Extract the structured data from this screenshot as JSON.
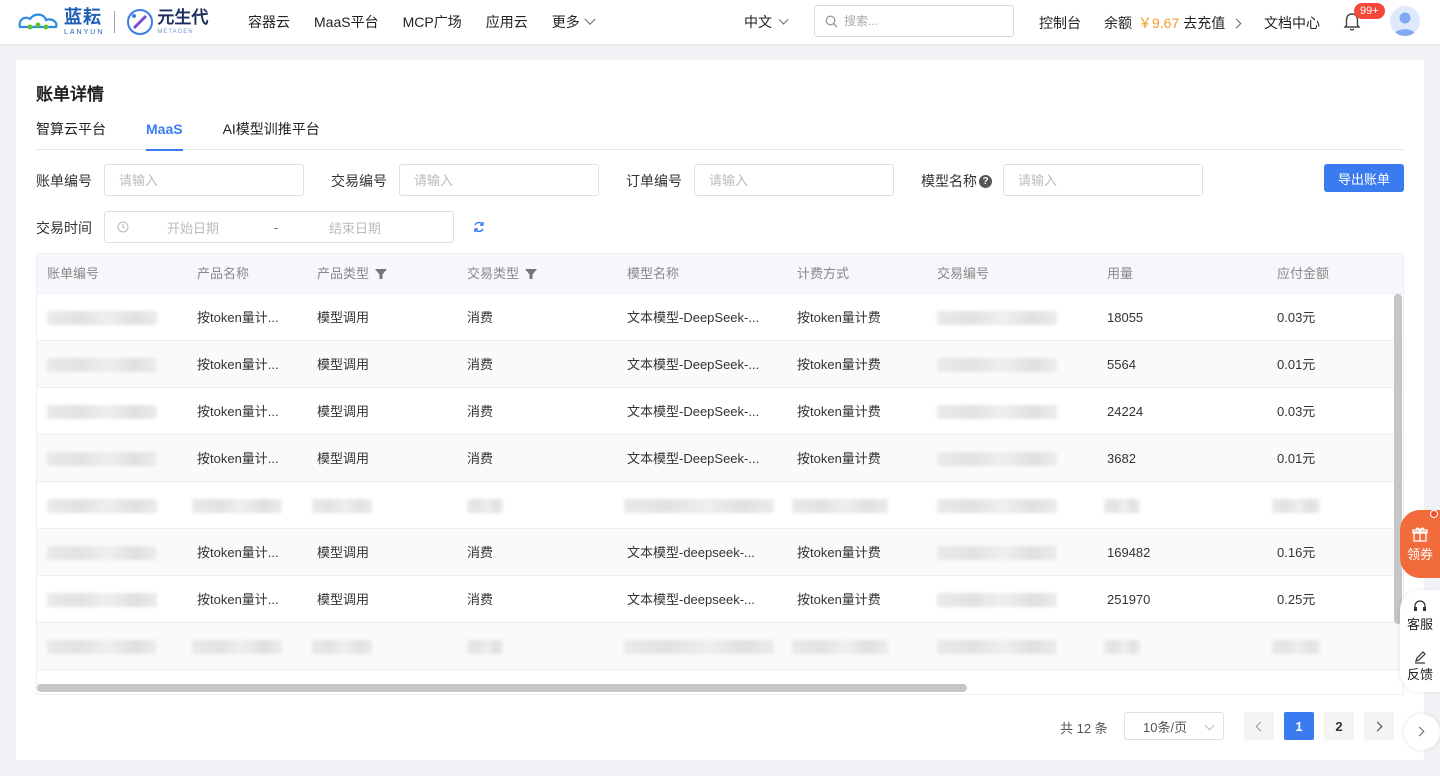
{
  "brand": {
    "lanyun_cn": "蓝耘",
    "lanyun_en": "LANYUN",
    "yuan_cn": "元生代",
    "yuan_en": "METAGEN"
  },
  "nav": {
    "items": [
      "容器云",
      "MaaS平台",
      "MCP广场",
      "应用云"
    ],
    "more": "更多"
  },
  "header": {
    "language": "中文",
    "search_placeholder": "搜索...",
    "console": "控制台",
    "balance_label": "余额",
    "balance_amount": "￥9.67",
    "recharge": "去充值",
    "docs": "文档中心",
    "notification_badge": "99+"
  },
  "page": {
    "title": "账单详情",
    "tabs": [
      {
        "label": "智算云平台",
        "active": false
      },
      {
        "label": "MaaS",
        "active": true
      },
      {
        "label": "AI模型训推平台",
        "active": false
      }
    ]
  },
  "filters": {
    "bill_no_label": "账单编号",
    "bill_no_placeholder": "请输入",
    "trade_no_label": "交易编号",
    "trade_no_placeholder": "请输入",
    "order_no_label": "订单编号",
    "order_no_placeholder": "请输入",
    "model_name_label": "模型名称",
    "model_name_placeholder": "请输入",
    "help_glyph": "?",
    "trade_time_label": "交易时间",
    "start_date": "开始日期",
    "date_sep": "-",
    "end_date": "结束日期",
    "export_button": "导出账单"
  },
  "table": {
    "columns": [
      "账单编号",
      "产品名称",
      "产品类型",
      "交易类型",
      "模型名称",
      "计费方式",
      "交易编号",
      "用量",
      "应付金额"
    ],
    "rows": [
      {
        "product": "按token量计...",
        "product_type": "模型调用",
        "trade_type": "消费",
        "model": "文本模型-DeepSeek-...",
        "billing": "按token量计费",
        "usage": "18055",
        "amount": "0.03元",
        "blurred": false
      },
      {
        "product": "按token量计...",
        "product_type": "模型调用",
        "trade_type": "消费",
        "model": "文本模型-DeepSeek-...",
        "billing": "按token量计费",
        "usage": "5564",
        "amount": "0.01元",
        "blurred": false
      },
      {
        "product": "按token量计...",
        "product_type": "模型调用",
        "trade_type": "消费",
        "model": "文本模型-DeepSeek-...",
        "billing": "按token量计费",
        "usage": "24224",
        "amount": "0.03元",
        "blurred": false
      },
      {
        "product": "按token量计...",
        "product_type": "模型调用",
        "trade_type": "消费",
        "model": "文本模型-DeepSeek-...",
        "billing": "按token量计费",
        "usage": "3682",
        "amount": "0.01元",
        "blurred": false
      },
      {
        "product": "",
        "product_type": "",
        "trade_type": "",
        "model": "",
        "billing": "",
        "usage": "",
        "amount": "",
        "blurred": true
      },
      {
        "product": "按token量计...",
        "product_type": "模型调用",
        "trade_type": "消费",
        "model": "文本模型-deepseek-...",
        "billing": "按token量计费",
        "usage": "169482",
        "amount": "0.16元",
        "blurred": false
      },
      {
        "product": "按token量计...",
        "product_type": "模型调用",
        "trade_type": "消费",
        "model": "文本模型-deepseek-...",
        "billing": "按token量计费",
        "usage": "251970",
        "amount": "0.25元",
        "blurred": false
      },
      {
        "product": "",
        "product_type": "",
        "trade_type": "",
        "model": "",
        "billing": "",
        "usage": "",
        "amount": "",
        "blurred": true
      }
    ]
  },
  "pagination": {
    "total": "共 12 条",
    "page_size": "10条/页",
    "pages": [
      "1",
      "2"
    ],
    "current": "1"
  },
  "side": {
    "coupon": "领券",
    "service": "客服",
    "feedback": "反馈"
  },
  "colors": {
    "primary": "#3a7bf0",
    "balance": "#f59a23",
    "coupon": "#f26b3a",
    "badge": "#f5483b"
  }
}
